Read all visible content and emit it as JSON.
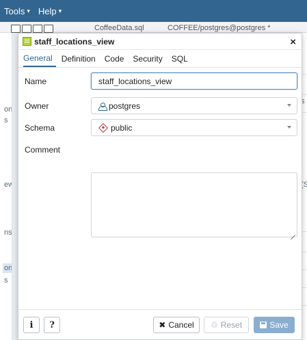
{
  "menubar": {
    "tools_label": "Tools",
    "help_label": "Help",
    "chevron": "▾"
  },
  "toolbar": {
    "file_tab": "CoffeeData.sql",
    "conn_tab": "COFFEE/postgres@postgres *"
  },
  "left_tree": [
    "ons",
    "s",
    "ews",
    "ns",
    "ons,",
    "s"
  ],
  "right_panel": [
    "s",
    "(S"
  ],
  "dialog": {
    "title": "staff_locations_view",
    "close": "×",
    "tabs": [
      "General",
      "Definition",
      "Code",
      "Security",
      "SQL"
    ],
    "active_tab": "General",
    "fields": {
      "name_label": "Name",
      "name_value": "staff_locations_view",
      "owner_label": "Owner",
      "owner_value": "postgres",
      "schema_label": "Schema",
      "schema_value": "public",
      "comment_label": "Comment",
      "comment_value": ""
    },
    "footer": {
      "info_label": "i",
      "help_label": "?",
      "cancel_label": "Cancel",
      "reset_label": "Reset",
      "save_label": "Save"
    }
  },
  "colors": {
    "menubar": "#326690",
    "accent": "#326690",
    "save_button": "#8aaed0",
    "schema_icon": "#d23a3a",
    "view_icon": "#b8d434"
  }
}
